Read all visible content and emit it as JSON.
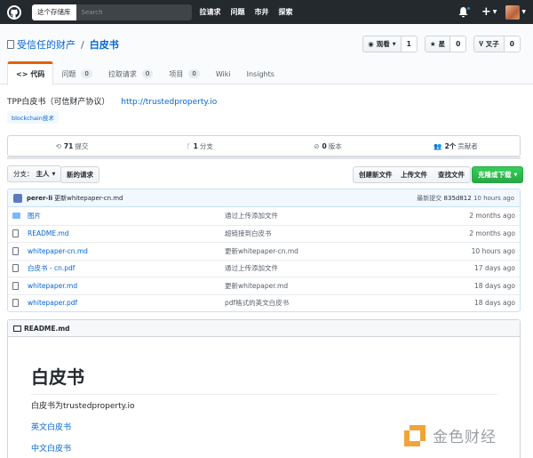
{
  "header": {
    "scope_label": "这个存储库",
    "search_placeholder": "Search",
    "nav": [
      "拉请求",
      "问题",
      "市井",
      "探索"
    ]
  },
  "repo": {
    "owner": "受信任的财产",
    "separator": "/",
    "name": "白皮书",
    "watch_label": "观看",
    "watch_count": "1",
    "star_label": "星",
    "star_count": "0",
    "fork_label": "叉子",
    "fork_count": "0"
  },
  "tabs": [
    {
      "label": "代码",
      "icon": "<>"
    },
    {
      "label": "问题",
      "count": "0"
    },
    {
      "label": "拉取请求",
      "count": "0"
    },
    {
      "label": "项目",
      "count": "0"
    },
    {
      "label": "Wiki"
    },
    {
      "label": "Insights"
    }
  ],
  "description": {
    "text": "TPP白皮书（可信财产协议）",
    "link": "http://trustedproperty.io",
    "topic": "blockchain技术"
  },
  "summary": {
    "commits_num": "71",
    "commits_label": "提交",
    "branches_num": "1",
    "branches_label": "分支",
    "releases_num": "0",
    "releases_label": "版本",
    "contributors_num": "2个",
    "contributors_label": "贡献者"
  },
  "filenav": {
    "branch_label": "分支：",
    "branch_name": "主人",
    "new_pr": "新的请求",
    "create_file": "创建新文件",
    "upload_file": "上传文件",
    "find_file": "查找文件",
    "clone": "克隆或下载"
  },
  "commit": {
    "author": "perer-li",
    "message": "更新whitepaper-cn.md",
    "latest_label": "最新提交",
    "sha": "835d812",
    "age": "10 hours ago"
  },
  "files": [
    {
      "type": "folder",
      "name": "图片",
      "message": "通过上传添加文件",
      "age": "2 months ago"
    },
    {
      "type": "file",
      "name": "README.md",
      "message": "超链接到白皮书",
      "age": "2 months ago"
    },
    {
      "type": "file",
      "name": "whitepaper-cn.md",
      "message": "更新whitepaper-cn.md",
      "age": "10 hours ago"
    },
    {
      "type": "file",
      "name": "白皮书 - cn.pdf",
      "message": "通过上传添加文件",
      "age": "17 days ago"
    },
    {
      "type": "file",
      "name": "whitepaper.md",
      "message": "更新whitepaper.md",
      "age": "18 days ago"
    },
    {
      "type": "file",
      "name": "whitepaper.pdf",
      "message": "pdf格式的英文白皮书",
      "age": "18 days ago"
    }
  ],
  "readme": {
    "filename": "README.md",
    "h1": "白皮书",
    "paragraph": "白皮书为trustedproperty.io",
    "link_en": "英文白皮书",
    "link_cn": "中文白皮书"
  },
  "watermark": {
    "text": "金色财经"
  }
}
